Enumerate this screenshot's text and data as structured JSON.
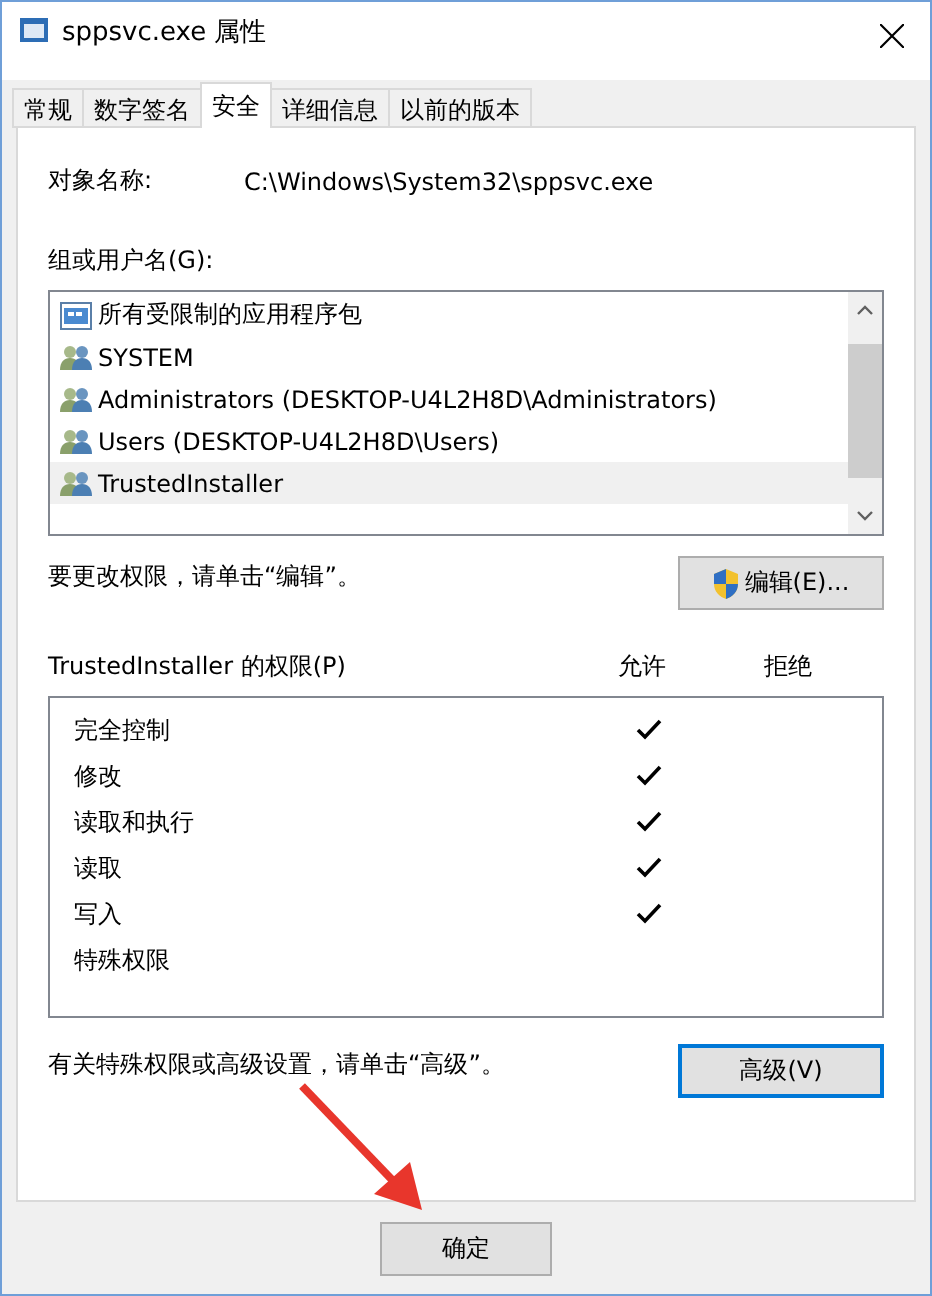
{
  "window": {
    "title": "sppsvc.exe 属性"
  },
  "tabs": [
    {
      "label": "常规",
      "selected": false
    },
    {
      "label": "数字签名",
      "selected": false
    },
    {
      "label": "安全",
      "selected": true
    },
    {
      "label": "详细信息",
      "selected": false
    },
    {
      "label": "以前的版本",
      "selected": false
    }
  ],
  "object_name": {
    "label": "对象名称:",
    "value": "C:\\Windows\\System32\\sppsvc.exe"
  },
  "groups": {
    "label": "组或用户名(G):",
    "items": [
      {
        "name": "所有受限制的应用程序包",
        "kind": "package",
        "selected": false
      },
      {
        "name": "SYSTEM",
        "kind": "group",
        "selected": false
      },
      {
        "name": "Administrators (DESKTOP-U4L2H8D\\Administrators)",
        "kind": "group",
        "selected": false
      },
      {
        "name": "Users (DESKTOP-U4L2H8D\\Users)",
        "kind": "group",
        "selected": false
      },
      {
        "name": "TrustedInstaller",
        "kind": "group",
        "selected": true
      }
    ]
  },
  "edit_hint": "要更改权限，请单击“编辑”。",
  "edit_button": "编辑(E)...",
  "permissions": {
    "label": "TrustedInstaller 的权限(P)",
    "allow_header": "允许",
    "deny_header": "拒绝",
    "rows": [
      {
        "name": "完全控制",
        "allow": true,
        "deny": false
      },
      {
        "name": "修改",
        "allow": true,
        "deny": false
      },
      {
        "name": "读取和执行",
        "allow": true,
        "deny": false
      },
      {
        "name": "读取",
        "allow": true,
        "deny": false
      },
      {
        "name": "写入",
        "allow": true,
        "deny": false
      },
      {
        "name": "特殊权限",
        "allow": false,
        "deny": false
      }
    ]
  },
  "advanced_hint": "有关特殊权限或高级设置，请单击“高级”。",
  "advanced_button": {
    "label": "高级(V)",
    "focused": true
  },
  "ok_button": "确定"
}
